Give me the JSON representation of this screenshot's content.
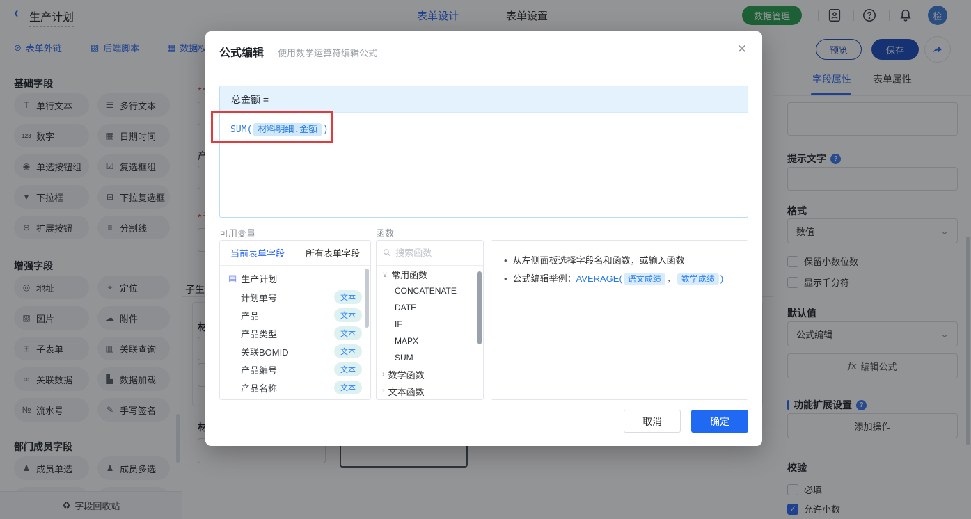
{
  "topbar": {
    "title": "生产计划",
    "tabs": [
      {
        "label": "表单设计"
      },
      {
        "label": "表单设置"
      }
    ],
    "data_manage_label": "数据管理",
    "avatar_text": "检"
  },
  "toolbar": {
    "links": [
      {
        "label": "表单外链"
      },
      {
        "label": "后端脚本"
      },
      {
        "label": "数据权"
      }
    ],
    "preview_label": "预览",
    "save_label": "保存"
  },
  "sidebar": {
    "sections": [
      {
        "title": "基础字段",
        "items": [
          "单行文本",
          "多行文本",
          "数字",
          "日期时间",
          "单选按钮组",
          "复选框组",
          "下拉框",
          "下拉复选框",
          "扩展按钮",
          "分割线"
        ]
      },
      {
        "title": "增强字段",
        "items": [
          "地址",
          "定位",
          "图片",
          "附件",
          "子表单",
          "关联查询",
          "关联数据",
          "数据加载",
          "流水号",
          "手写签名"
        ]
      },
      {
        "title": "部门成员字段",
        "items": [
          "成员单选",
          "成员多选"
        ]
      }
    ],
    "recycle_label": "字段回收站"
  },
  "canvas": {
    "fields": [
      {
        "req": "*",
        "label": "计"
      },
      {
        "req": "",
        "label": "产"
      },
      {
        "req": "*",
        "label": "计"
      }
    ],
    "section_label": "子生",
    "sub_label": "材",
    "bottom_label": "材"
  },
  "modal": {
    "title": "公式编辑",
    "subtitle": "使用数学运算符编辑公式",
    "formula": {
      "target": "总金额 =",
      "fn": "SUM(",
      "arg": "材料明细.金额",
      "end": ")"
    },
    "variables": {
      "label": "可用变量",
      "tabs": [
        "当前表单字段",
        "所有表单字段"
      ],
      "root": "生产计划",
      "fields": [
        {
          "name": "计划单号",
          "type": "文本"
        },
        {
          "name": "产品",
          "type": "文本"
        },
        {
          "name": "产品类型",
          "type": "文本"
        },
        {
          "name": "关联BOMID",
          "type": "文本"
        },
        {
          "name": "产品编号",
          "type": "文本"
        },
        {
          "name": "产品名称",
          "type": "文本"
        }
      ]
    },
    "functions": {
      "label": "函数",
      "search_placeholder": "搜索函数",
      "group_common": "常用函数",
      "common_items": [
        "CONCATENATE",
        "DATE",
        "IF",
        "MAPX",
        "SUM"
      ],
      "group_math": "数学函数",
      "group_text": "文本函数"
    },
    "tips": {
      "line1": "从左侧面板选择字段名和函数，或输入函数",
      "line2_prefix": "公式编辑举例：",
      "line2_fn": "AVERAGE(",
      "chip1": "语文成绩",
      "sep": "，",
      "chip2": "数学成绩",
      "end": ")"
    },
    "cancel_label": "取消",
    "ok_label": "确定"
  },
  "rightbar": {
    "tabs": [
      "字段属性",
      "表单属性"
    ],
    "hint_label": "提示文字",
    "format_label": "格式",
    "format_value": "数值",
    "cb_decimal_digits": "保留小数位数",
    "cb_thousand": "显示千分符",
    "default_label": "默认值",
    "default_value": "公式编辑",
    "fx": "fx",
    "edit_formula_label": "编辑公式",
    "ext_label": "功能扩展设置",
    "add_action_label": "添加操作",
    "validate_label": "校验",
    "cb_required": "必填",
    "cb_allow_decimal": "允许小数"
  },
  "icons": {
    "back": "‹",
    "close": "✕",
    "chevron_down": "⌄",
    "chevron_right": "›",
    "tree_collapse": "∨",
    "doc": "▤",
    "search": "⚲",
    "help": "?",
    "recycle": "♻",
    "link": "⊘",
    "script": "▨",
    "perm": "▦",
    "text": "T",
    "textarea": "☰",
    "number": "123",
    "datetime": "▦",
    "radio": "◉",
    "checkbox": "☑",
    "select": "▾",
    "multiselect": "⊟",
    "extend": "⊖",
    "divider": "≡",
    "address": "◎",
    "locate": "⌖",
    "image": "▧",
    "attach": "☁",
    "subform": "⊞",
    "lookup": "▥",
    "linkdata": "∞",
    "dataload": "▙",
    "serial": "№",
    "sign": "✎",
    "member": "♟",
    "members": "♟"
  },
  "colors": {
    "primary": "#2b6af3",
    "save_navy": "#1d4dbe",
    "green": "#2aa150",
    "annotation_red": "#e23b3b",
    "ok_blue": "#2069f3"
  }
}
